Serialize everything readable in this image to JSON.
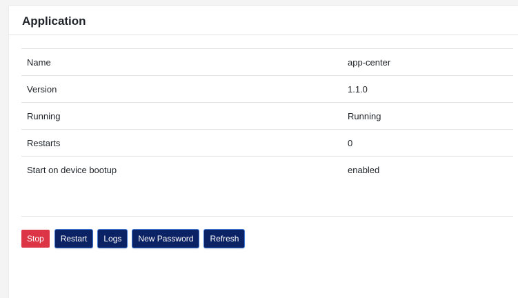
{
  "card": {
    "title": "Application"
  },
  "info": {
    "rows": [
      {
        "label": "Name",
        "value": "app-center"
      },
      {
        "label": "Version",
        "value": "1.1.0"
      },
      {
        "label": "Running",
        "value": "Running"
      },
      {
        "label": "Restarts",
        "value": "0"
      },
      {
        "label": "Start on device bootup",
        "value": "enabled"
      }
    ]
  },
  "actions": {
    "stop_label": "Stop",
    "restart_label": "Restart",
    "logs_label": "Logs",
    "new_password_label": "New Password",
    "refresh_label": "Refresh"
  },
  "colors": {
    "danger": "#dc3545",
    "primary": "#0b2265",
    "primary_outline": "#3f7ad9"
  }
}
